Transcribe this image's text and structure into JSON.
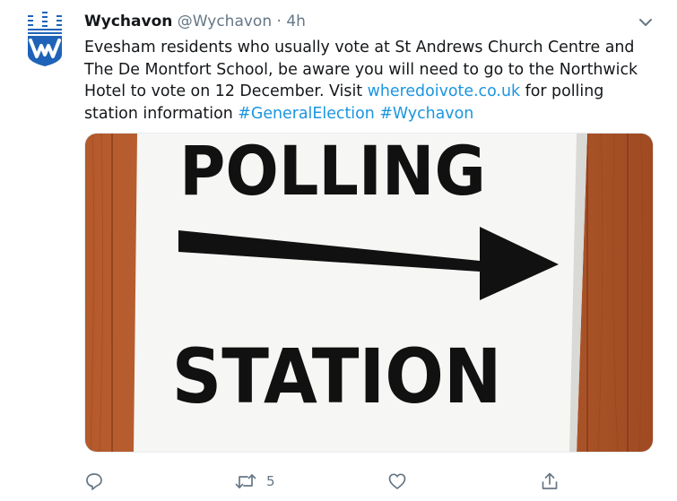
{
  "tweet": {
    "author_name": "Wychavon",
    "handle": "@Wychavon",
    "separator": "·",
    "time": "4h",
    "body": {
      "text_1": "Evesham residents who usually vote at St Andrews Church Centre and The De Montfort School, be aware you will need to go to the Northwick Hotel to vote on 12 December. Visit ",
      "link": "wheredoivote.co.uk",
      "text_2": " for polling station information ",
      "hashtag_1": "#GeneralElection",
      "space": " ",
      "hashtag_2": "#Wychavon"
    },
    "media": {
      "sign_top": "POLLING",
      "sign_bottom": "STATION"
    },
    "actions": {
      "reply_icon": "reply-icon",
      "retweet_icon": "retweet-icon",
      "retweet_count": "5",
      "like_icon": "heart-icon",
      "share_icon": "share-icon"
    }
  },
  "colors": {
    "link": "#1b95e0",
    "muted": "#657786",
    "logo_blue": "#1e63b8"
  }
}
